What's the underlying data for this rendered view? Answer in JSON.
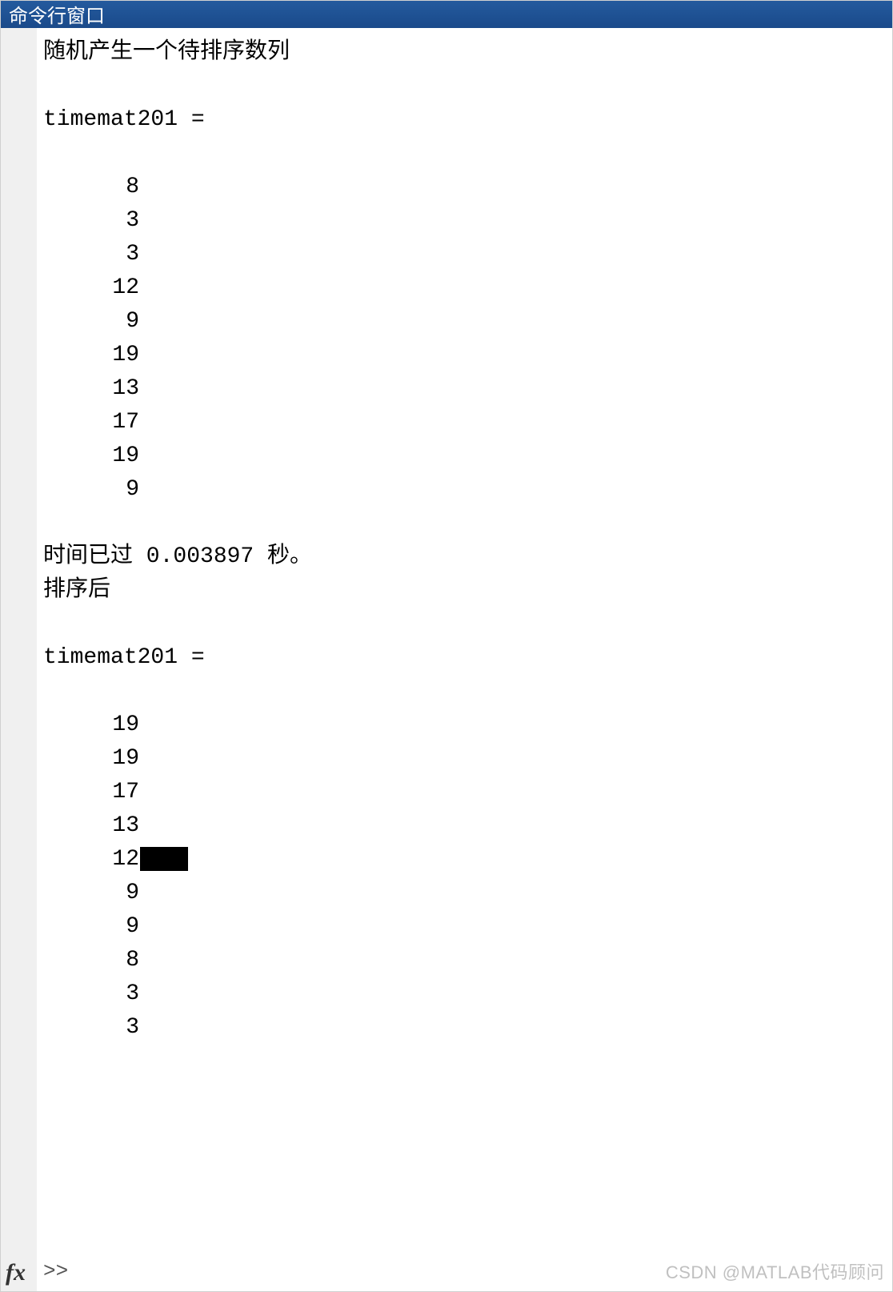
{
  "window": {
    "title": "命令行窗口"
  },
  "output": {
    "msg_generate": "随机产生一个待排序数列",
    "var_header_1": "timemat201 =",
    "values_before": [
      "8",
      "3",
      "3",
      "12",
      "9",
      "19",
      "13",
      "17",
      "19",
      "9"
    ],
    "elapsed": "时间已过 0.003897 秒。",
    "msg_sorted": "排序后",
    "var_header_2": "timemat201 =",
    "values_after": [
      "19",
      "19",
      "17",
      "13",
      "12",
      "9",
      "9",
      "8",
      "3",
      "3"
    ]
  },
  "prompt": {
    "fx_label": "fx",
    "symbol": ">>"
  },
  "watermark": "CSDN @MATLAB代码顾问"
}
